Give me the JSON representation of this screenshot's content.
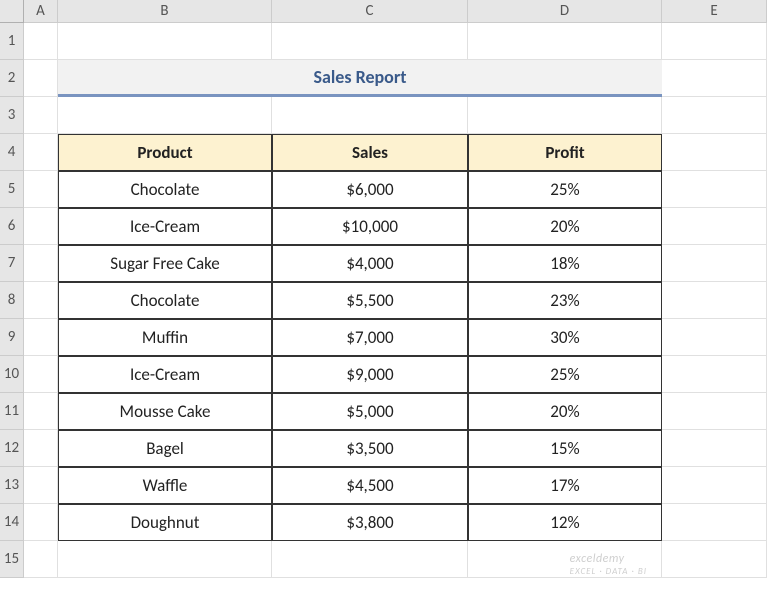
{
  "columns": [
    "A",
    "B",
    "C",
    "D",
    "E"
  ],
  "rows": [
    "1",
    "2",
    "3",
    "4",
    "5",
    "6",
    "7",
    "8",
    "9",
    "10",
    "11",
    "12",
    "13",
    "14",
    "15"
  ],
  "title": "Sales Report",
  "headers": {
    "product": "Product",
    "sales": "Sales",
    "profit": "Profit"
  },
  "data": [
    {
      "product": "Chocolate",
      "sales": "$6,000",
      "profit": "25%"
    },
    {
      "product": "Ice-Cream",
      "sales": "$10,000",
      "profit": "20%"
    },
    {
      "product": "Sugar Free Cake",
      "sales": "$4,000",
      "profit": "18%"
    },
    {
      "product": "Chocolate",
      "sales": "$5,500",
      "profit": "23%"
    },
    {
      "product": "Muffin",
      "sales": "$7,000",
      "profit": "30%"
    },
    {
      "product": "Ice-Cream",
      "sales": "$9,000",
      "profit": "25%"
    },
    {
      "product": "Mousse Cake",
      "sales": "$5,000",
      "profit": "20%"
    },
    {
      "product": "Bagel",
      "sales": "$3,500",
      "profit": "15%"
    },
    {
      "product": "Waffle",
      "sales": "$4,500",
      "profit": "17%"
    },
    {
      "product": "Doughnut",
      "sales": "$3,800",
      "profit": "12%"
    }
  ],
  "watermark": {
    "main": "exceldemy",
    "sub": "EXCEL · DATA · BI"
  }
}
